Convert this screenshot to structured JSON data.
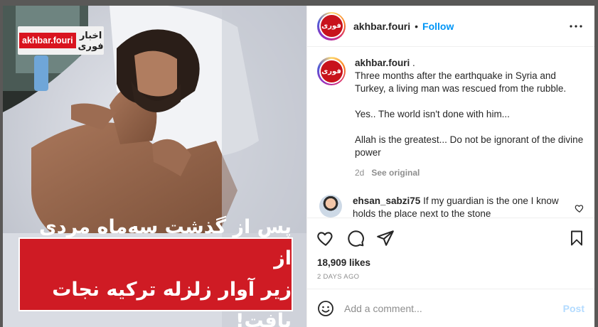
{
  "media": {
    "logo_en": "akhbar.fouri",
    "logo_fa_line1": "اخبار",
    "logo_fa_line2": "فوری",
    "banner_line1": "پس از گذشت سه‌ماه مردی از",
    "banner_line2": "زیر آوار زلزله ترکیه نجات یافت!"
  },
  "header": {
    "avatar_text": "فوری",
    "username": "akhbar.fouri",
    "separator": "•",
    "follow_label": "Follow"
  },
  "caption": {
    "username": "akhbar.fouri",
    "suffix": " .",
    "text": "Three months after the earthquake in Syria and Turkey, a living man was rescued from the rubble.\n\nYes.. The world isn't done with him...\n\nAllah is the greatest... Do not be ignorant of the divine power",
    "age": "2d",
    "see_original": "See original"
  },
  "comment": {
    "username": "ehsan_sabzi75",
    "text": "If my guardian is the one I know holds the place next to the stone"
  },
  "stats": {
    "likes": "18,909 likes",
    "time_ago": "2 DAYS AGO"
  },
  "add_comment": {
    "placeholder": "Add a comment...",
    "post_label": "Post"
  },
  "colors": {
    "accent": "#0095f6",
    "brand_red": "#cf1b24",
    "muted": "#8e8e8e"
  },
  "icons": [
    "more-icon",
    "heart-icon",
    "comment-icon",
    "share-icon",
    "save-icon",
    "emoji-icon",
    "heart-small-icon"
  ]
}
